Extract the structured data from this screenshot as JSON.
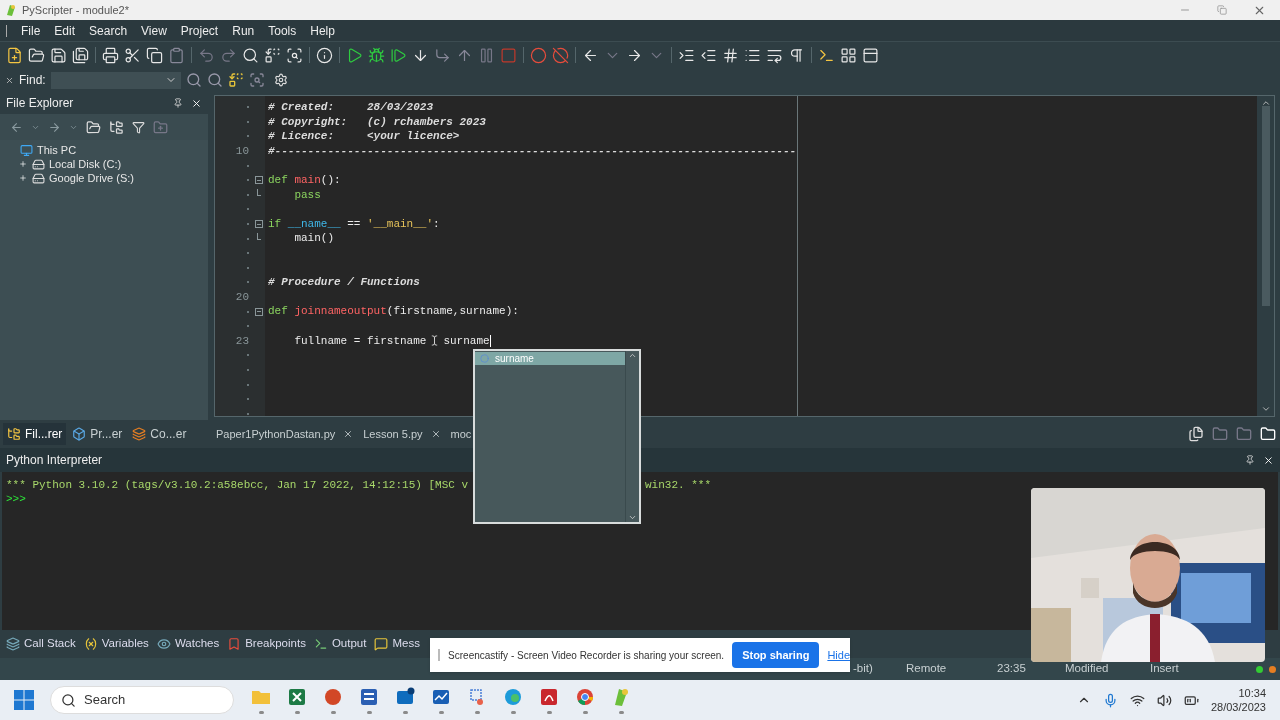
{
  "window": {
    "title": "PyScripter - module2*"
  },
  "menu": [
    "File",
    "Edit",
    "Search",
    "View",
    "Project",
    "Run",
    "Tools",
    "Help"
  ],
  "find_bar": {
    "label": "Find:"
  },
  "file_explorer": {
    "title": "File Explorer",
    "tree": [
      {
        "label": "This PC",
        "expanded": true,
        "children": [
          {
            "label": "Local Disk (C:)",
            "expanded": false
          },
          {
            "label": "Google Drive (S:)",
            "expanded": false
          }
        ]
      }
    ]
  },
  "editor": {
    "lines": [
      {
        "kind": "code",
        "tokens": [
          {
            "kind": "comment",
            "text": "# Created:     28/03/2023"
          }
        ]
      },
      {
        "kind": "code",
        "tokens": [
          {
            "kind": "comment",
            "text": "# Copyright:   (c) rchambers 2023"
          }
        ]
      },
      {
        "kind": "code",
        "tokens": [
          {
            "kind": "comment",
            "text": "# Licence:     <your licence>"
          }
        ]
      },
      {
        "kind": "code",
        "number": "10",
        "tokens": [
          {
            "kind": "comment",
            "text": "#-------------------------------------------------------------------------------"
          }
        ]
      },
      {
        "kind": "blank"
      },
      {
        "kind": "code",
        "fold_start": true,
        "tokens": [
          {
            "kind": "keyword",
            "text": "def"
          },
          {
            "kind": "function",
            "text": "main",
            "gap": true
          },
          {
            "kind": "plain",
            "text": "():"
          }
        ]
      },
      {
        "kind": "code",
        "fold_end": true,
        "indent": true,
        "tokens": [
          {
            "kind": "keyword",
            "text": "pass"
          }
        ]
      },
      {
        "kind": "blank"
      },
      {
        "kind": "code",
        "fold_start": true,
        "tokens": [
          {
            "kind": "keyword",
            "text": "if"
          },
          {
            "kind": "dunder",
            "text": "__name__",
            "gap": true
          },
          {
            "kind": "plain",
            "text": " == "
          },
          {
            "kind": "string",
            "text": "'__main__'"
          },
          {
            "kind": "plain",
            "text": ":"
          }
        ]
      },
      {
        "kind": "code",
        "fold_end": true,
        "indent": true,
        "tokens": [
          {
            "kind": "plain",
            "text": "main()"
          }
        ]
      },
      {
        "kind": "blank"
      },
      {
        "kind": "blank"
      },
      {
        "kind": "code",
        "tokens": [
          {
            "kind": "comment",
            "text": "# Procedure / Functions"
          }
        ]
      },
      {
        "kind": "blank",
        "number": "20"
      },
      {
        "kind": "code",
        "fold_start": true,
        "tokens": [
          {
            "kind": "keyword",
            "text": "def"
          },
          {
            "kind": "function",
            "text": "joinnameoutput",
            "gap": true
          },
          {
            "kind": "plain",
            "text": "(firstname,surname):"
          }
        ]
      },
      {
        "kind": "blank"
      },
      {
        "kind": "code",
        "number": "23",
        "indent": true,
        "caret": true,
        "tokens": [
          {
            "kind": "plain",
            "text": "fullname = firstname"
          },
          {
            "kind": "pointer"
          },
          {
            "kind": "plain",
            "text": "surname"
          }
        ]
      },
      {
        "kind": "blank"
      },
      {
        "kind": "blank"
      },
      {
        "kind": "blank"
      },
      {
        "kind": "blank"
      },
      {
        "kind": "blank"
      }
    ]
  },
  "autocomplete": [
    {
      "text": "surname",
      "selected": true
    }
  ],
  "panel_tabs": [
    {
      "label": "Fil...rer",
      "selected": true
    },
    {
      "label": "Pr...er",
      "selected": false
    },
    {
      "label": "Co...er",
      "selected": false
    }
  ],
  "editor_tabs": [
    {
      "label": "Paper1PythonDastan.py",
      "closable": true
    },
    {
      "label": "Lesson 5.py",
      "closable": true
    },
    {
      "label": "moc",
      "closable": false
    }
  ],
  "interpreter": {
    "title": "Python Interpreter",
    "banner": [
      "*** Python 3.10.2 (tags/v3.10.2:a58ebcc, Jan 17 2022, 14:12:15) [MSC v",
      "win32. ***"
    ],
    "prompt": ">>>"
  },
  "bottom_tabs": [
    "Call Stack",
    "Variables",
    "Watches",
    "Breakpoints",
    "Output",
    "Mess"
  ],
  "status_bar": [
    "-bit)",
    "Remote",
    "23:35",
    "Modified",
    "Insert"
  ],
  "share_bar": {
    "message": "Screencastify - Screen Video Recorder is sharing your screen.",
    "button": "Stop sharing",
    "link": "Hide"
  },
  "webcam": {
    "kind": "picture"
  },
  "taskbar": {
    "search": "Search",
    "time": "10:34",
    "date": "28/03/2023"
  }
}
